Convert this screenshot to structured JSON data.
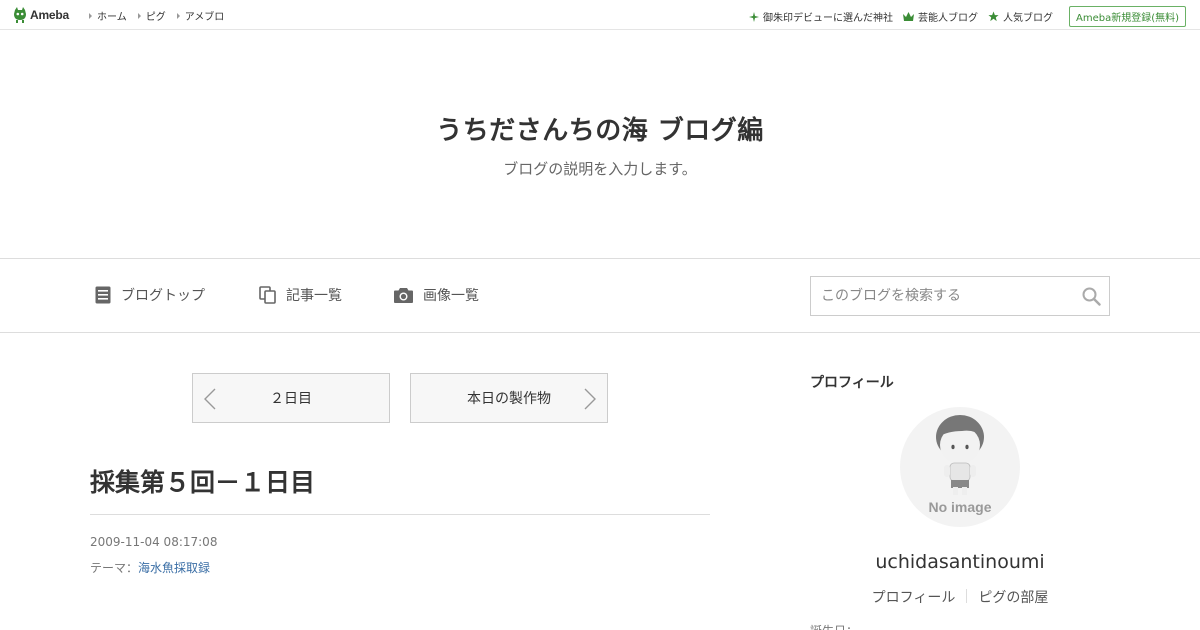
{
  "topbar": {
    "logo_text": "Ameba",
    "nav": [
      "ホーム",
      "ピグ",
      "アメブロ"
    ],
    "right_links": [
      "御朱印デビューに選んだ神社",
      "芸能人ブログ",
      "人気ブログ"
    ],
    "register_label": "Ameba新規登録(無料)"
  },
  "header": {
    "title": "うちださんちの海 ブログ編",
    "description": "ブログの説明を入力します。"
  },
  "navbar": {
    "items": [
      "ブログトップ",
      "記事一覧",
      "画像一覧"
    ],
    "search_placeholder": "このブログを検索する"
  },
  "pager": {
    "prev_label": "２日目",
    "next_label": "本日の製作物"
  },
  "entry": {
    "title": "採集第５回－１日目",
    "date": "2009-11-04 08:17:08",
    "theme_label": "テーマ：",
    "theme_link": "海水魚採取録"
  },
  "sidebar": {
    "heading": "プロフィール",
    "avatar_text": "No image",
    "username": "uchidasantinoumi",
    "links": [
      "プロフィール",
      "ピグの部屋"
    ],
    "cut_text": "誕生日："
  },
  "colors": {
    "accent_green": "#3b8d36",
    "link_blue": "#3a6ea5"
  }
}
